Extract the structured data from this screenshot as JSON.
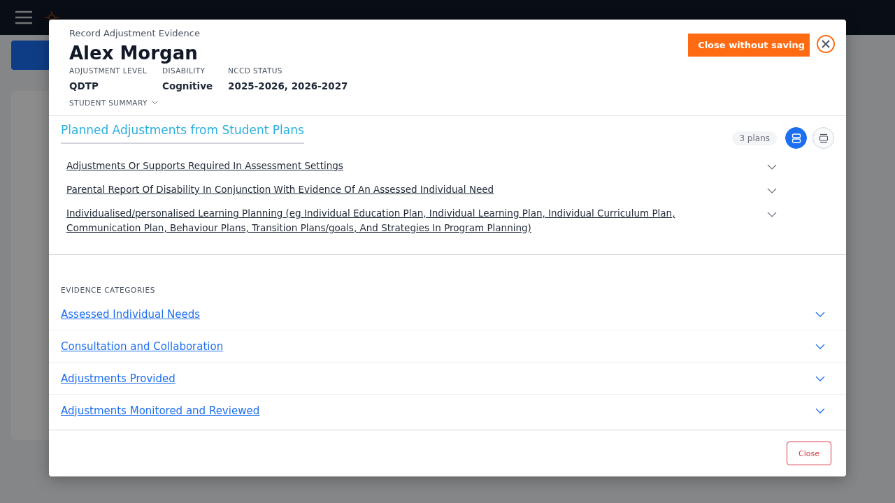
{
  "modal": {
    "subtitle": "Record Adjustment Evidence",
    "student_name": "Alex Morgan",
    "details": [
      {
        "label": "ADJUSTMENT LEVEL",
        "value": "QDTP"
      },
      {
        "label": "DISABILITY",
        "value": "Cognitive"
      },
      {
        "label": "NCCD STATUS",
        "value": "2025-2026, 2026-2027"
      }
    ],
    "summary_toggle": {
      "label": "STUDENT SUMMARY",
      "expanded": false
    },
    "close_without_saving": "Close without saving",
    "planned": {
      "title": "Planned Adjustments from Student Plans",
      "count": "3 plans",
      "views": [
        {
          "kind": "stacked",
          "selected": true
        },
        {
          "kind": "single",
          "selected": false
        }
      ],
      "items": [
        {
          "text": "Adjustments Or Supports Required In Assessment Settings",
          "expanded": false
        },
        {
          "text": "Parental Report Of Disability In Conjunction With Evidence Of An Assessed Individual Need",
          "expanded": false
        },
        {
          "text": "Individualised/personalised Learning Planning (eg Individual Education Plan, Individual Learning Plan, Individual Curriculum Plan, Communication Plan, Behaviour Plans, Transition Plans/goals, And Strategies In Program Planning)",
          "expanded": false
        }
      ]
    },
    "evidence": {
      "heading": "EVIDENCE CATEGORIES",
      "items": [
        {
          "text": "Assessed Individual Needs",
          "expanded": false
        },
        {
          "text": "Consultation and Collaboration",
          "expanded": false
        },
        {
          "text": "Adjustments Provided",
          "expanded": false
        },
        {
          "text": "Adjustments Monitored and Reviewed",
          "expanded": false
        }
      ]
    },
    "close_button": "Close"
  }
}
